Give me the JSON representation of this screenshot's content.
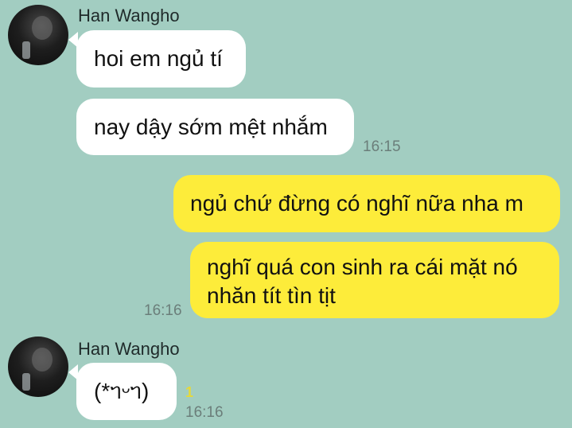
{
  "chat": {
    "messages": [
      {
        "sender": "Han Wangho",
        "avatar_icon": "profile-photo",
        "bubbles": [
          "hoi em ngủ tí",
          "nay dậy sớm mệt nhắm"
        ],
        "time": "16:15"
      },
      {
        "direction": "outgoing",
        "bubbles": [
          "ngủ chứ đừng có nghĩ nữa nha m",
          "nghĩ quá con sinh ra cái mặt nó nhăn tít tìn tịt"
        ],
        "line1": "nghĩ quá con sinh ra cái mặt nó",
        "line2": "nhăn tít tìn tịt",
        "time": "16:16"
      },
      {
        "sender": "Han Wangho",
        "avatar_icon": "profile-photo",
        "bubbles": [
          "(*ᥐ᠋ᵕᥐ᠋)"
        ],
        "unread_count": "1",
        "time": "16:16"
      }
    ]
  },
  "colors": {
    "background": "#a2cdc1",
    "incoming_bubble": "#ffffff",
    "outgoing_bubble": "#fdec3a",
    "unread": "#e6d93a",
    "timestamp": "#6b7e7a"
  }
}
